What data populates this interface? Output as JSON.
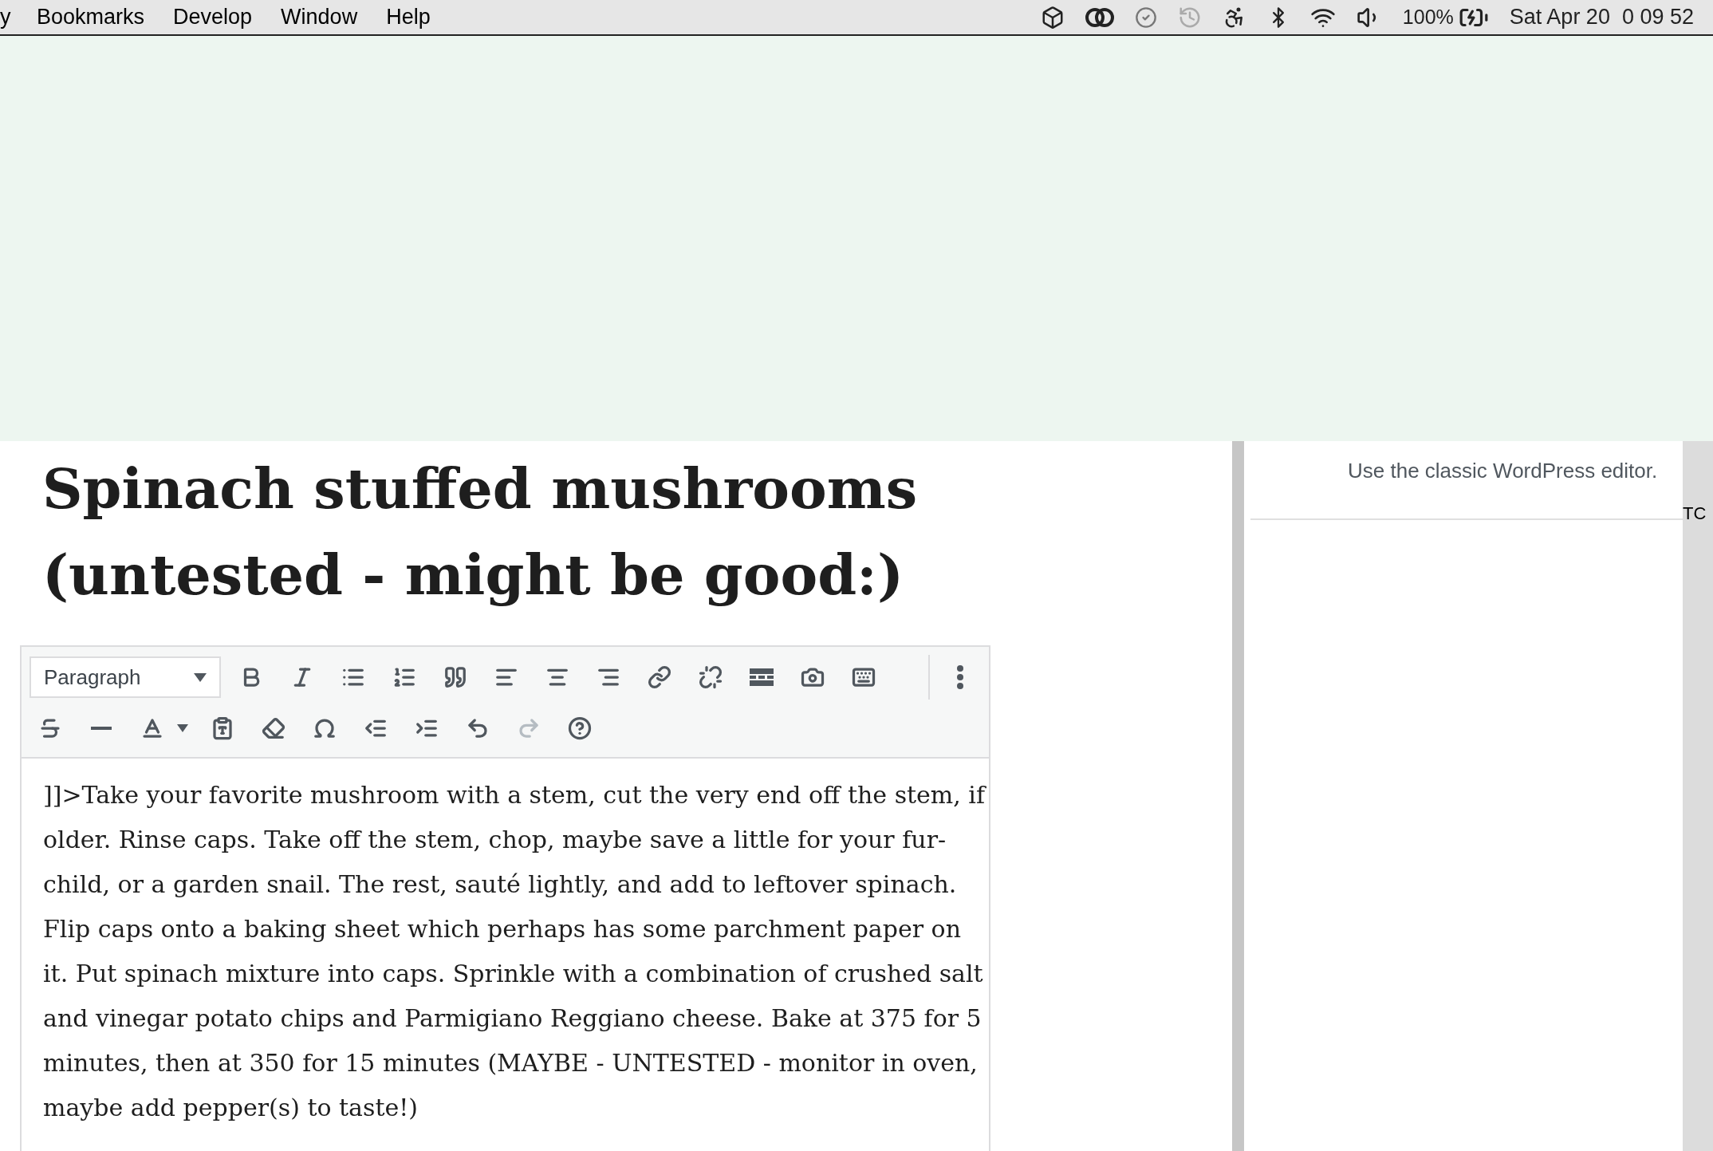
{
  "menu_bar": {
    "items": [
      "y",
      "Bookmarks",
      "Develop",
      "Window",
      "Help"
    ],
    "battery": "100%",
    "clock": "Sat Apr 20  0 09 52"
  },
  "post_title": "Spinach stuffed mushrooms (untested - might be good:)",
  "format_select": {
    "value": "Paragraph"
  },
  "toolbar_rows": [
    [
      {
        "kind": "bold",
        "disabled": false
      },
      {
        "kind": "italic",
        "disabled": false
      },
      {
        "kind": "bullets",
        "disabled": false
      },
      {
        "kind": "numbers",
        "disabled": false
      },
      {
        "kind": "quote",
        "disabled": false
      },
      {
        "kind": "align-left",
        "disabled": false
      },
      {
        "kind": "align-center",
        "disabled": false
      },
      {
        "kind": "align-right",
        "disabled": false
      },
      {
        "kind": "link",
        "disabled": false
      },
      {
        "kind": "unlink",
        "disabled": false
      },
      {
        "kind": "more",
        "disabled": false
      },
      {
        "kind": "media",
        "disabled": false
      },
      {
        "kind": "keyboard",
        "disabled": false
      }
    ],
    [
      {
        "kind": "strike",
        "disabled": false
      },
      {
        "kind": "rule",
        "disabled": false
      },
      {
        "kind": "text-color",
        "disabled": false
      },
      {
        "kind": "paste",
        "disabled": false
      },
      {
        "kind": "eraser",
        "disabled": false
      },
      {
        "kind": "omega",
        "disabled": false
      },
      {
        "kind": "outdent",
        "disabled": false
      },
      {
        "kind": "indent",
        "disabled": false
      },
      {
        "kind": "undo",
        "disabled": false
      },
      {
        "kind": "redo",
        "disabled": true
      },
      {
        "kind": "help",
        "disabled": false
      }
    ]
  ],
  "body_text": "]]>Take your favorite mushroom with a stem, cut the very end off the stem, if older.  Rinse caps.  Take off the stem, chop, maybe save a little for your fur-child, or a garden snail.  The rest, sauté lightly, and add to leftover spinach.  Flip caps onto a baking sheet which perhaps has some parchment paper on it.  Put spinach mixture into caps.  Sprinkle with a combination of crushed salt and vinegar potato chips and Parmigiano Reggiano cheese.  Bake at 375 for 5 minutes, then at 350 for 15 minutes (MAYBE - UNTESTED - monitor in oven, maybe add pepper(s) to taste!)",
  "sidebar": {
    "description": "Use the classic WordPress editor."
  },
  "edge_text": "TC"
}
